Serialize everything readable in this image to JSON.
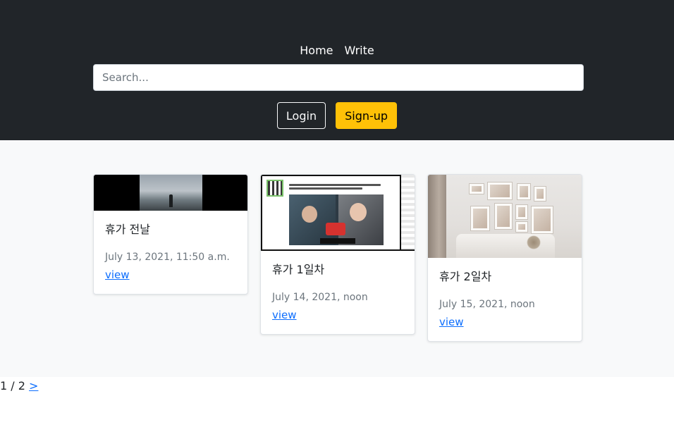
{
  "nav": {
    "items": [
      {
        "label": "Home"
      },
      {
        "label": "Write"
      }
    ]
  },
  "search": {
    "placeholder": "Search...",
    "value": ""
  },
  "auth": {
    "login_label": "Login",
    "signup_label": "Sign-up"
  },
  "posts": [
    {
      "title": "휴가 전날",
      "date": "July 13, 2021, 11:50 a.m.",
      "link": "view",
      "thumbnail": "beach-silhouette-image"
    },
    {
      "title": "휴가 1일차",
      "date": "July 14, 2021, noon",
      "link": "view",
      "thumbnail": "video-screenshot-image"
    },
    {
      "title": "휴가 2일차",
      "date": "July 15, 2021, noon",
      "link": "view",
      "thumbnail": "living-room-image"
    }
  ],
  "pagination": {
    "current": "1",
    "separator": "/",
    "total": "2",
    "next_label": ">"
  },
  "colors": {
    "header_bg": "#212529",
    "main_bg": "#f8f9fa",
    "accent_warning": "#ffc107",
    "link": "#0d6efd"
  }
}
